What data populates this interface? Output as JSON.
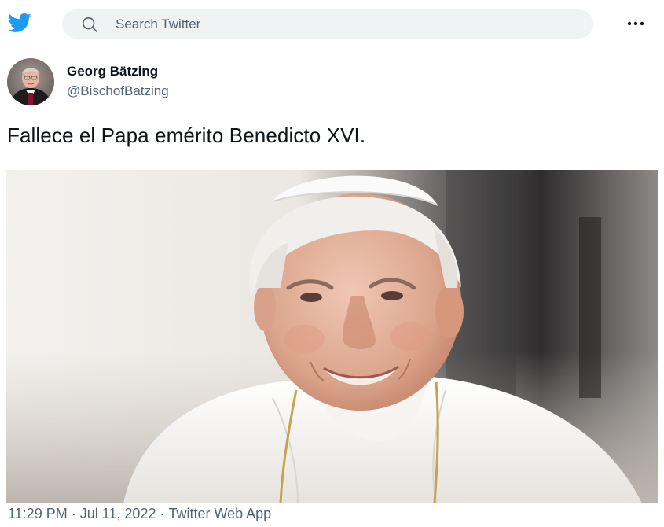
{
  "header": {
    "logo_icon": "twitter-bird-icon",
    "search": {
      "placeholder": "Search Twitter",
      "value": ""
    },
    "more_icon": "more-dots-icon"
  },
  "tweet": {
    "author": {
      "display_name": "Georg Bätzing",
      "handle": "@BischofBatzing"
    },
    "text": "Fallece el Papa emérito Benedicto XVI.",
    "meta": {
      "time": "11:29 PM",
      "date": "Jul 11, 2022",
      "source": "Twitter Web App",
      "separator": "·"
    }
  },
  "colors": {
    "brand": "#1d9bf0",
    "text_primary": "#0f1419",
    "text_secondary": "#536471",
    "search_bg": "#eff3f4"
  }
}
